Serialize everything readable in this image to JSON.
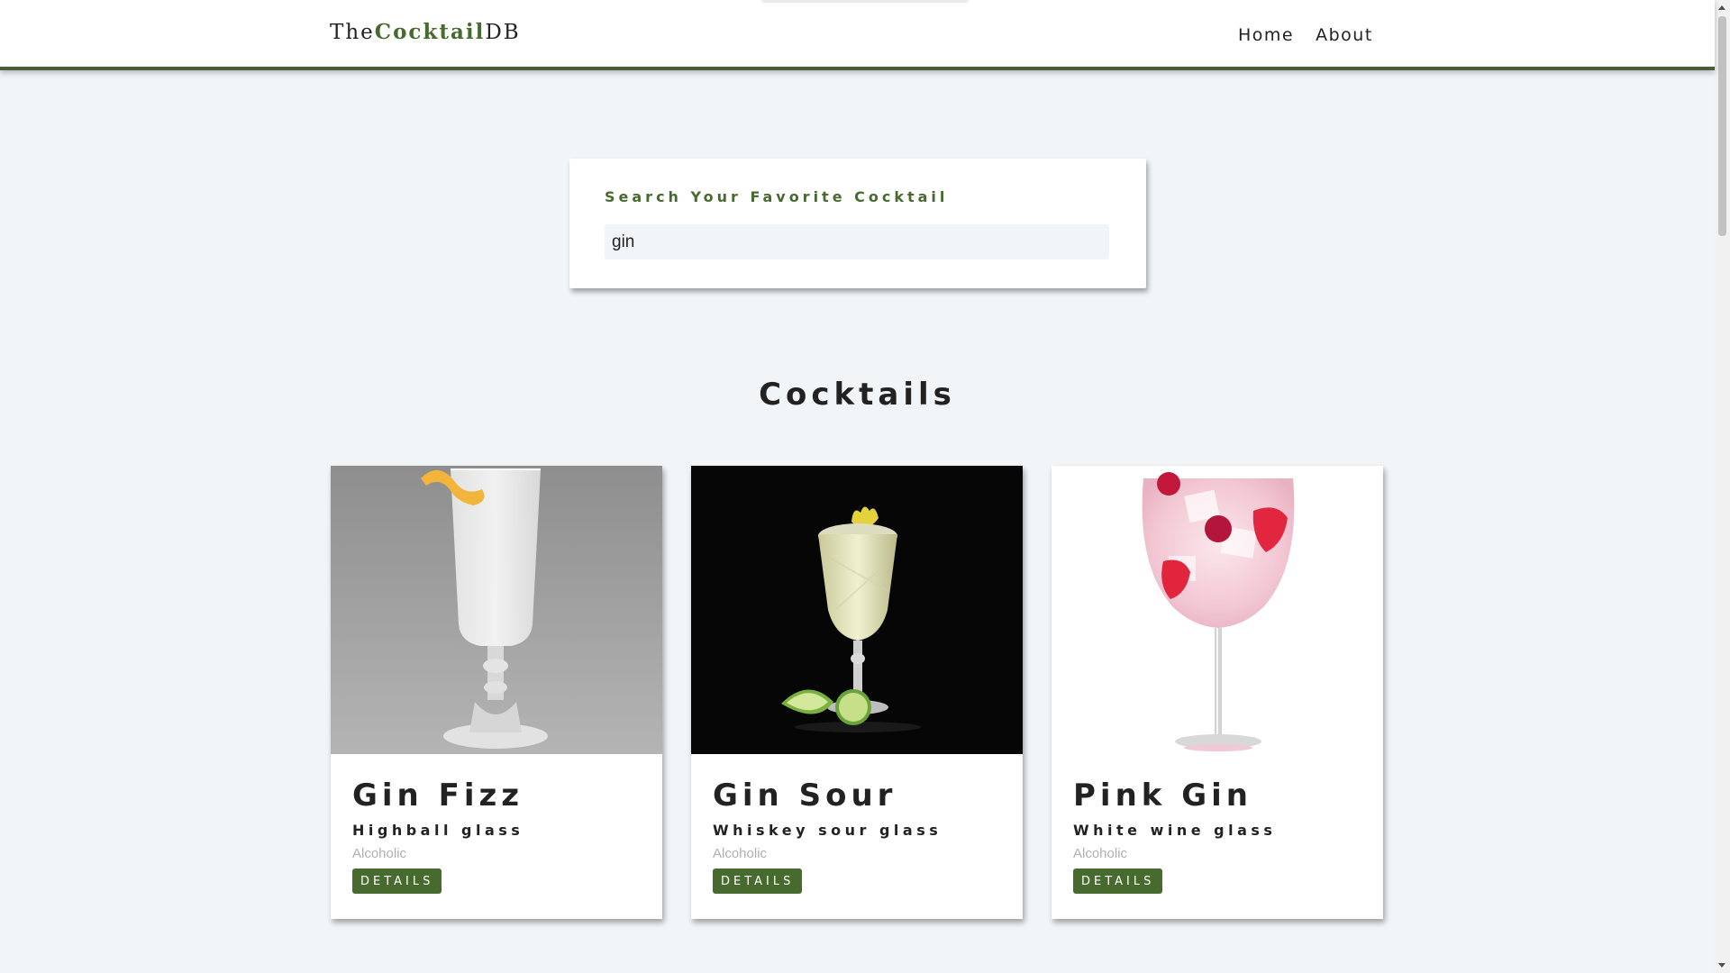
{
  "navbar": {
    "logo_prefix": "The",
    "logo_accent": "Cocktail",
    "logo_suffix": "DB",
    "links": [
      "Home",
      "About"
    ]
  },
  "search": {
    "label": "Search Your Favorite Cocktail",
    "value": "gin"
  },
  "section_title": "Cocktails",
  "cocktails": [
    {
      "name": "Gin Fizz",
      "glass": "Highball glass",
      "type": "Alcoholic",
      "button": "DETAILS",
      "image": "gin-fizz-highball-photo"
    },
    {
      "name": "Gin Sour",
      "glass": "Whiskey sour glass",
      "type": "Alcoholic",
      "button": "DETAILS",
      "image": "gin-sour-glass-photo"
    },
    {
      "name": "Pink Gin",
      "glass": "White wine glass",
      "type": "Alcoholic",
      "button": "DETAILS",
      "image": "pink-gin-wine-glass-photo"
    }
  ],
  "colors": {
    "accent": "#476b2e",
    "background": "#f1f5f8",
    "navbar_border": "#4a5d3a"
  }
}
